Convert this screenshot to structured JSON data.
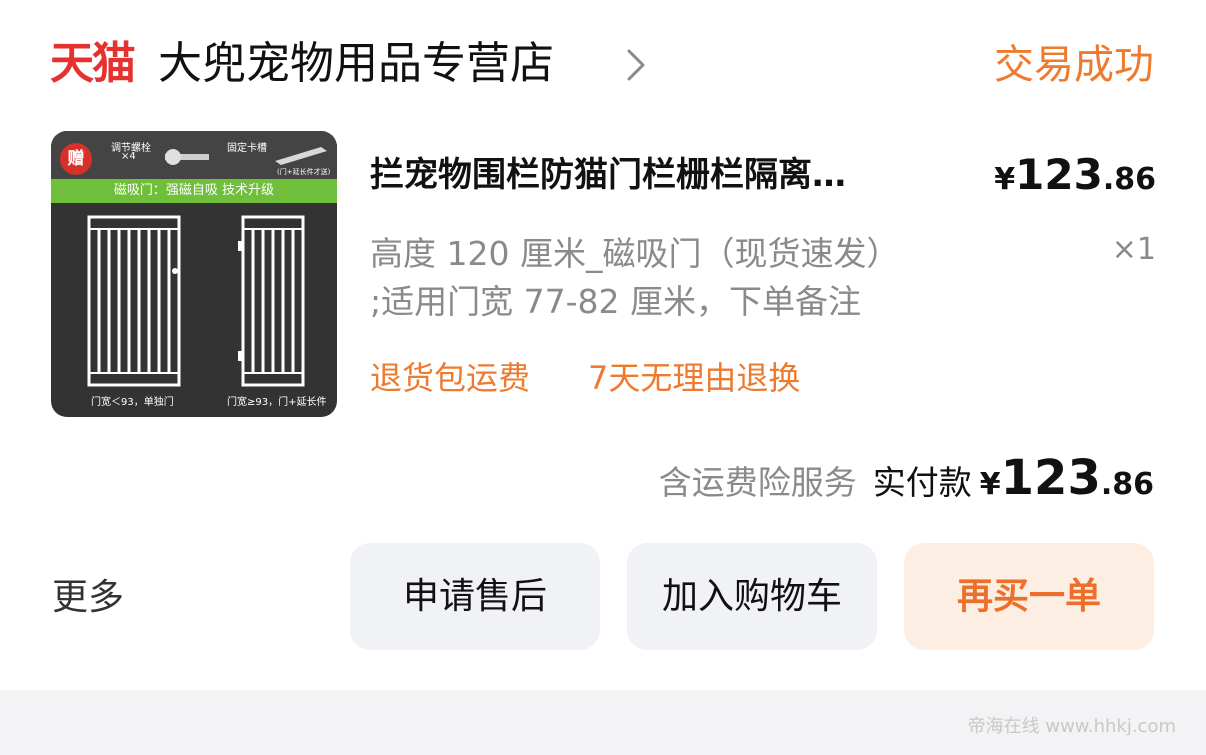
{
  "header": {
    "platform_logo": "天猫",
    "shop_name": "大兜宠物用品专营店",
    "status": "交易成功"
  },
  "product": {
    "thumbnail": {
      "gift_badge": "赠",
      "part_1": "调节螺栓",
      "part_1_qty": "×4",
      "part_2": "固定卡槽",
      "part_2_note": "(门+延长件才送)",
      "banner": "磁吸门：强磁自吸 技术升级",
      "caption_left": "门宽＜93，单独门",
      "caption_right": "门宽≥93，门+延长件"
    },
    "title": "拦宠物围栏防猫门栏栅栏隔离…",
    "price_symbol": "¥",
    "price_integer": "123",
    "price_decimal": ".86",
    "sku_line_1": "高度 120 厘米_磁吸门（现货速发）",
    "sku_line_2": ";适用门宽 77-82 厘米，下单备注",
    "quantity": "×1",
    "tags": [
      "退货包运费",
      "7天无理由退换"
    ]
  },
  "total": {
    "note": "含运费险服务",
    "label": "实付款",
    "symbol": "¥",
    "integer": "123",
    "decimal": ".86"
  },
  "actions": {
    "more": "更多",
    "after_sale": "申请售后",
    "add_to_cart": "加入购物车",
    "buy_again": "再买一单"
  },
  "colors": {
    "tmall_red": "#e5312f",
    "accent_orange": "#ee7a2f",
    "banner_green": "#6fbf3a"
  },
  "watermark": "帝海在线 www.hhkj.com"
}
